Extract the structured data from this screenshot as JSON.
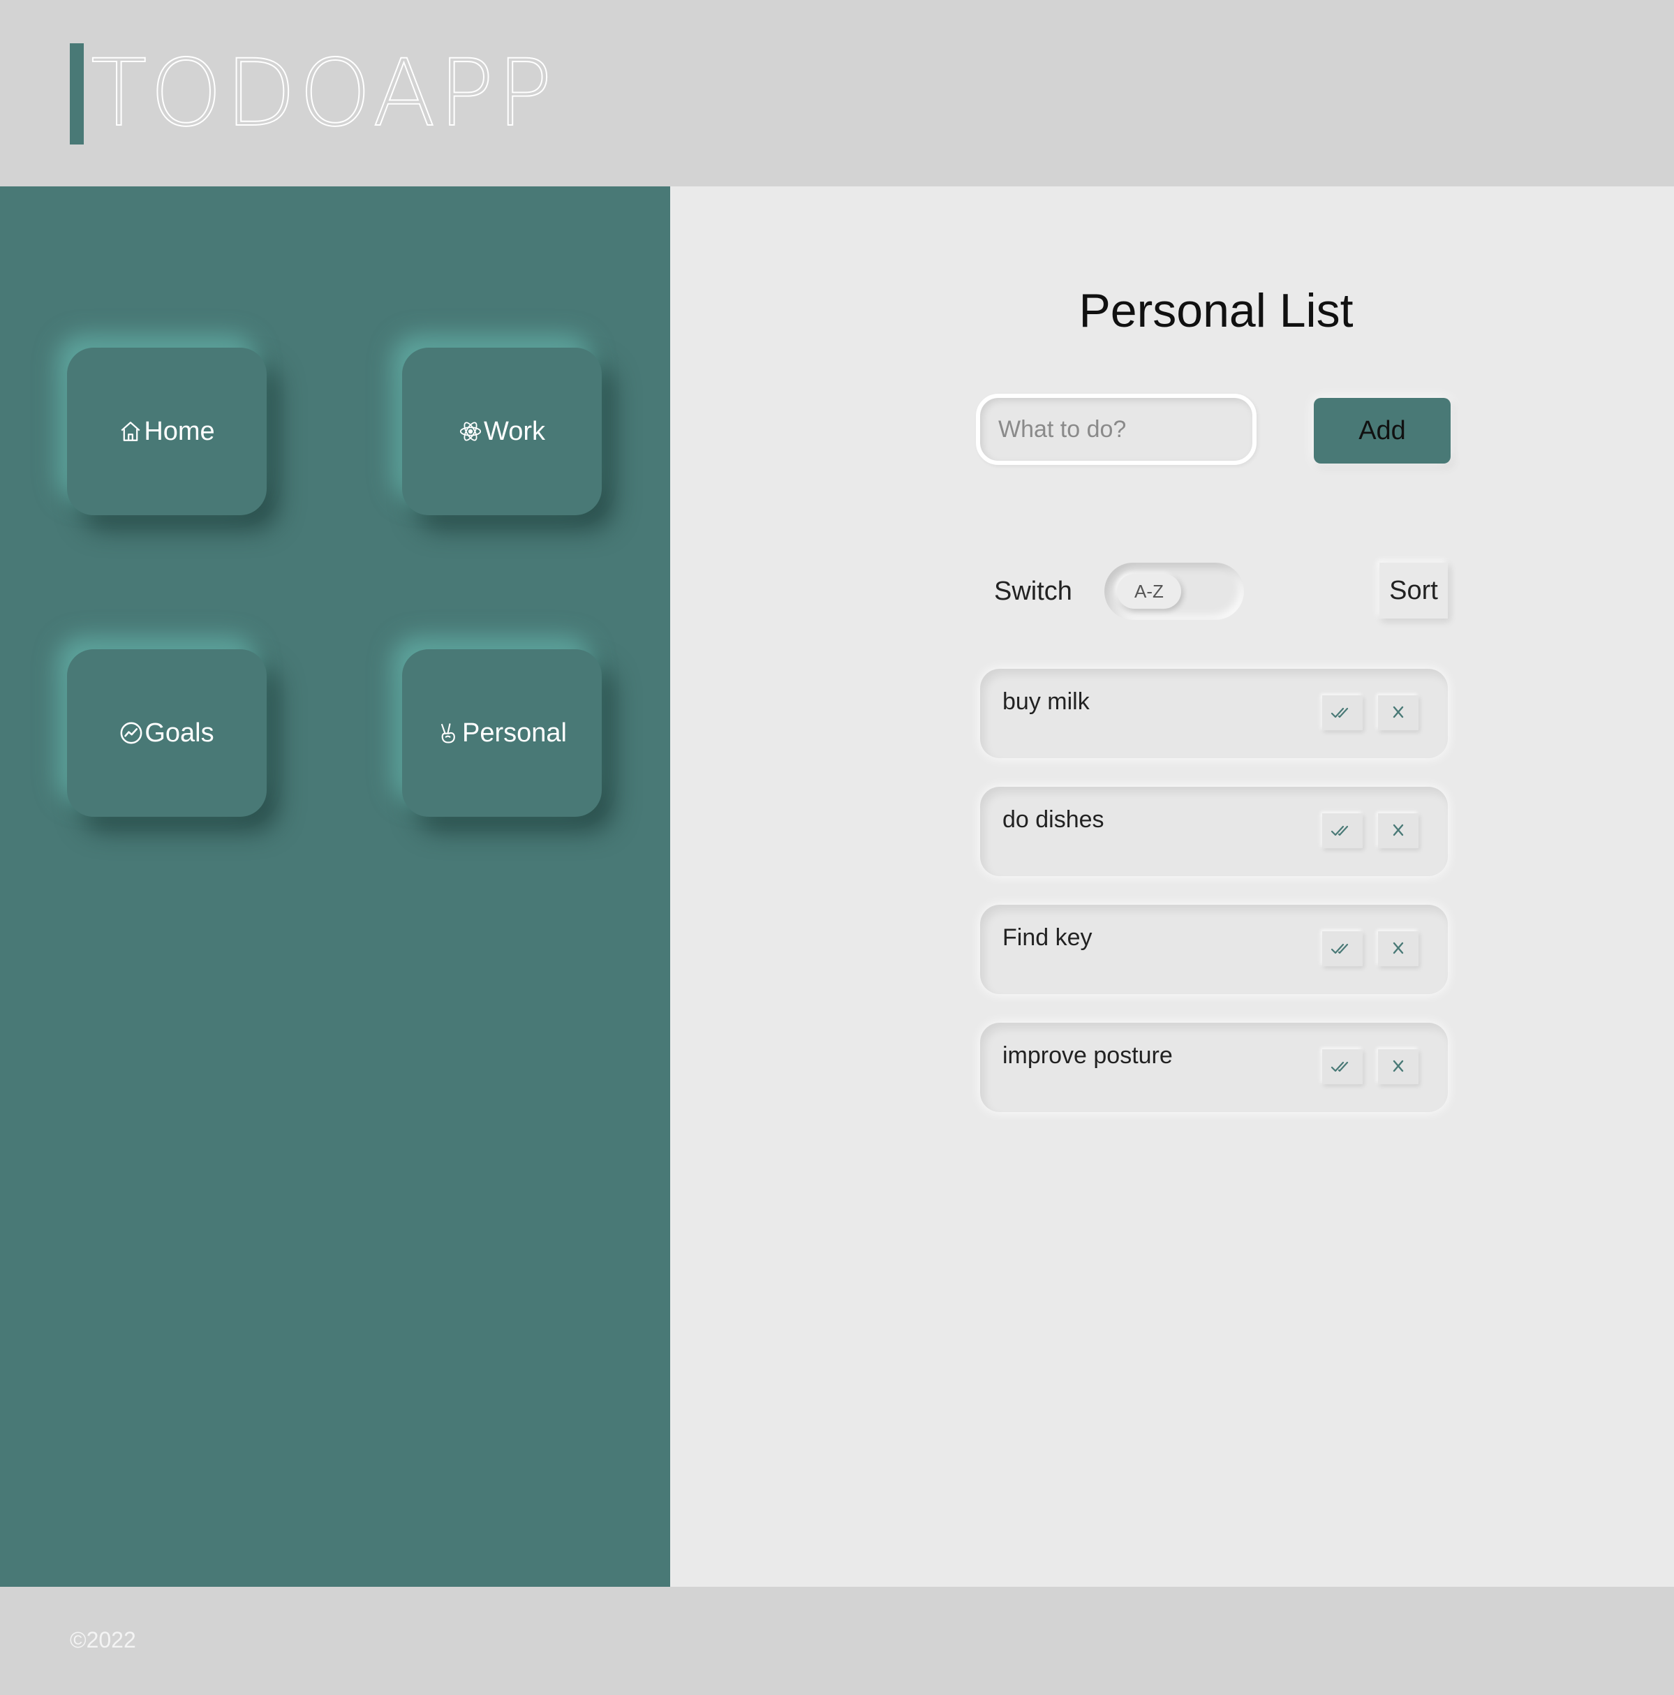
{
  "header": {
    "logo": "TODOAPP"
  },
  "sidebar": {
    "items": [
      {
        "label": "Home",
        "icon": "home-icon"
      },
      {
        "label": "Work",
        "icon": "atom-icon"
      },
      {
        "label": "Goals",
        "icon": "chart-circle-icon"
      },
      {
        "label": "Personal",
        "icon": "peace-hand-icon"
      }
    ]
  },
  "main": {
    "title": "Personal List",
    "input_placeholder": "What to do?",
    "add_label": "Add",
    "switch_label": "Switch",
    "toggle_label": "A-Z",
    "sort_label": "Sort",
    "todos": [
      {
        "text": "buy milk"
      },
      {
        "text": "do dishes"
      },
      {
        "text": "Find key"
      },
      {
        "text": "improve posture"
      }
    ]
  },
  "footer": {
    "text": "©2022"
  },
  "colors": {
    "accent": "#497976",
    "header_bg": "#d3d3d3",
    "main_bg": "#eaeaea"
  }
}
